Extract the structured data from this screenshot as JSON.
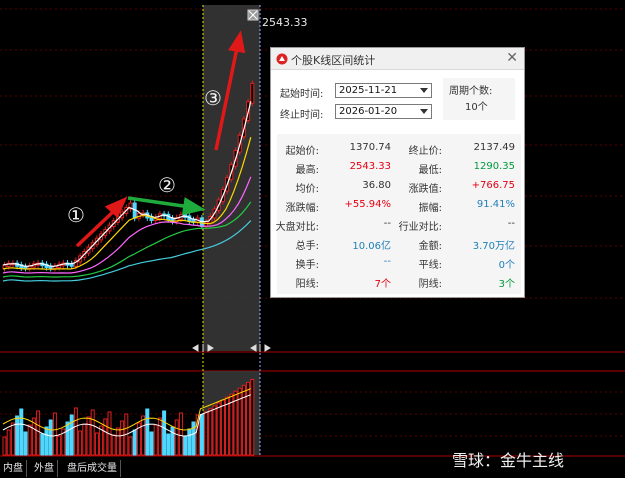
{
  "price_high_label": "2543.33",
  "annotations": [
    "①",
    "②",
    "③"
  ],
  "tabs": [
    "内盘",
    "外盘",
    "盘后成交量"
  ],
  "watermark": "雪球：金牛主线",
  "dialog": {
    "title": "个股K线区间统计",
    "start_label": "起始时间:",
    "start_value": "2025-11-21",
    "end_label": "终止时间:",
    "end_value": "2026-01-20",
    "count_label": "周期个数:",
    "count_value": "10个",
    "stats": [
      {
        "k1": "起始价:",
        "v1": "1370.74",
        "c1": "norm",
        "k2": "终止价:",
        "v2": "2137.49",
        "c2": "norm"
      },
      {
        "k1": "最高:",
        "v1": "2543.33",
        "c1": "red",
        "k2": "最低:",
        "v2": "1290.35",
        "c2": "green"
      },
      {
        "k1": "均价:",
        "v1": "36.80",
        "c1": "norm",
        "k2": "涨跌值:",
        "v2": "+766.75",
        "c2": "red"
      },
      {
        "k1": "涨跌幅:",
        "v1": "+55.94%",
        "c1": "red",
        "k2": "振幅:",
        "v2": "91.41%",
        "c2": "blue"
      },
      {
        "k1": "大盘对比:",
        "v1": "--",
        "c1": "norm",
        "k2": "行业对比:",
        "v2": "--",
        "c2": "norm"
      },
      {
        "k1": "总手:",
        "v1": "10.06亿",
        "c1": "blue",
        "k2": "金额:",
        "v2": "3.70万亿",
        "c2": "blue"
      },
      {
        "k1": "换手:",
        "v1": "--",
        "c1": "blue",
        "k2": "平线:",
        "v2": "0个",
        "c2": "blue"
      },
      {
        "k1": "阳线:",
        "v1": "7个",
        "c1": "red",
        "k2": "阴线:",
        "v2": "3个",
        "c2": "green"
      }
    ]
  },
  "colors": {
    "up": "#e02020",
    "down": "#4fd8ff",
    "ma1": "#ffffff",
    "ma2": "#ffd700",
    "ma3": "#ff66ff",
    "ma4": "#22cc44",
    "ma5": "#44ccdd"
  }
}
